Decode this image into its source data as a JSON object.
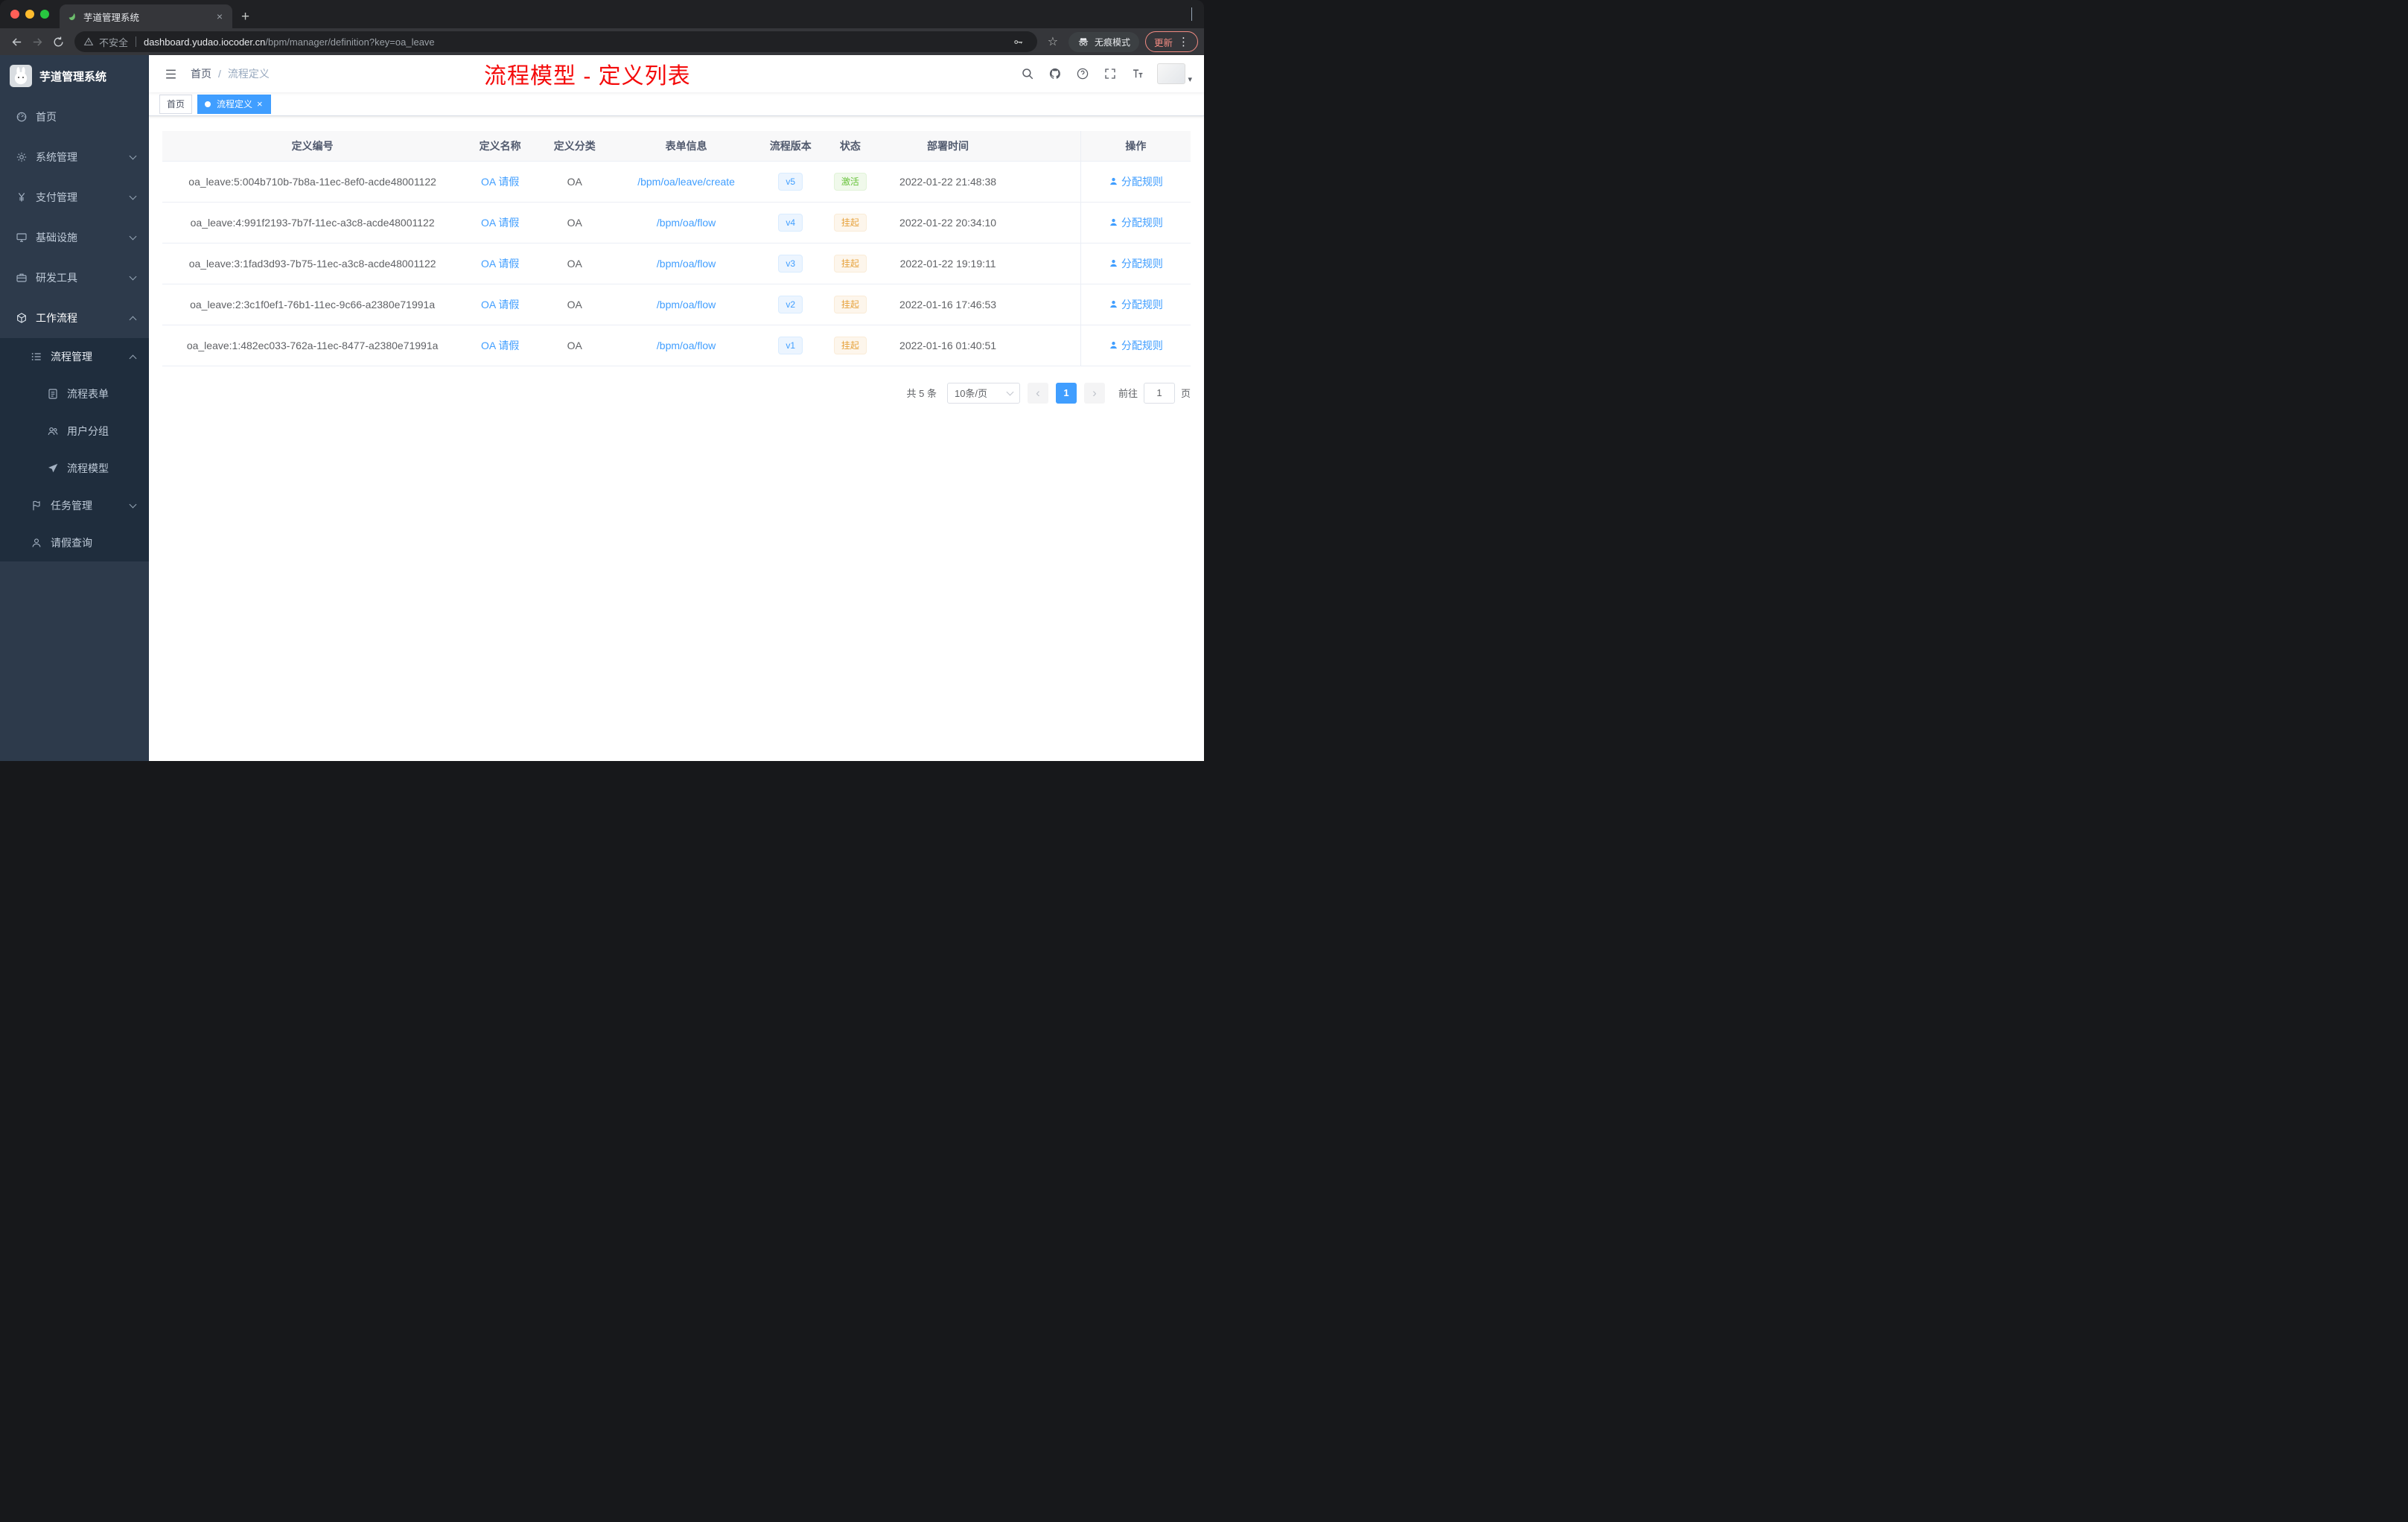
{
  "colors": {
    "accent": "#409eff",
    "success": "#67c23a",
    "warning": "#e6a23c",
    "annotation_red": "#f40b0b",
    "sidebar_bg": "#2d3a4b",
    "submenu_bg": "#1f2d3d"
  },
  "glyphs": {
    "close": "×",
    "plus": "+",
    "star": "☆",
    "dots": "⋮",
    "caret": "▾",
    "prev": "‹",
    "next": "›"
  },
  "browser": {
    "tab": {
      "title": "芋道管理系统"
    },
    "toolbar": {
      "security_label": "不安全",
      "url_host": "dashboard.yudao.iocoder.cn",
      "url_path": "/bpm/manager/definition?key=oa_leave",
      "incognito_label": "无痕模式",
      "update_label": "更新"
    }
  },
  "sidebar": {
    "logo_title": "芋道管理系统",
    "items": [
      {
        "icon": "dashboard",
        "label": "首页",
        "level": 1,
        "arrow": ""
      },
      {
        "icon": "gear",
        "label": "系统管理",
        "level": 1,
        "arrow": "down"
      },
      {
        "icon": "yen",
        "label": "支付管理",
        "level": 1,
        "arrow": "down"
      },
      {
        "icon": "monitor",
        "label": "基础设施",
        "level": 1,
        "arrow": "down"
      },
      {
        "icon": "briefcase",
        "label": "研发工具",
        "level": 1,
        "arrow": "down"
      },
      {
        "icon": "cube",
        "label": "工作流程",
        "level": 1,
        "arrow": "up",
        "state": "active"
      },
      {
        "icon": "list",
        "label": "流程管理",
        "level": 2,
        "arrow": "up",
        "state": "open"
      },
      {
        "icon": "document",
        "label": "流程表单",
        "level": 3,
        "arrow": ""
      },
      {
        "icon": "users",
        "label": "用户分组",
        "level": 3,
        "arrow": ""
      },
      {
        "icon": "send",
        "label": "流程模型",
        "level": 3,
        "arrow": ""
      },
      {
        "icon": "flag",
        "label": "任务管理",
        "level": 2,
        "arrow": "down"
      },
      {
        "icon": "user",
        "label": "请假查询",
        "level": 2,
        "arrow": ""
      }
    ]
  },
  "navbar": {
    "breadcrumb": {
      "home": "首页",
      "separator": "/",
      "current": "流程定义"
    },
    "annotation": "流程模型 - 定义列表"
  },
  "tags": {
    "home": {
      "label": "首页"
    },
    "active": {
      "label": "流程定义"
    }
  },
  "table": {
    "columns": [
      "定义编号",
      "定义名称",
      "定义分类",
      "表单信息",
      "流程版本",
      "状态",
      "部署时间",
      "操作"
    ],
    "rows": [
      {
        "id": "oa_leave:5:004b710b-7b8a-11ec-8ef0-acde48001122",
        "name": "OA 请假",
        "category": "OA",
        "form": "/bpm/oa/leave/create",
        "version": "v5",
        "status": "激活",
        "status_type": "success",
        "time": "2022-01-22 21:48:38",
        "action": "分配规则"
      },
      {
        "id": "oa_leave:4:991f2193-7b7f-11ec-a3c8-acde48001122",
        "name": "OA 请假",
        "category": "OA",
        "form": "/bpm/oa/flow",
        "version": "v4",
        "status": "挂起",
        "status_type": "warning",
        "time": "2022-01-22 20:34:10",
        "action": "分配规则"
      },
      {
        "id": "oa_leave:3:1fad3d93-7b75-11ec-a3c8-acde48001122",
        "name": "OA 请假",
        "category": "OA",
        "form": "/bpm/oa/flow",
        "version": "v3",
        "status": "挂起",
        "status_type": "warning",
        "time": "2022-01-22 19:19:11",
        "action": "分配规则"
      },
      {
        "id": "oa_leave:2:3c1f0ef1-76b1-11ec-9c66-a2380e71991a",
        "name": "OA 请假",
        "category": "OA",
        "form": "/bpm/oa/flow",
        "version": "v2",
        "status": "挂起",
        "status_type": "warning",
        "time": "2022-01-16 17:46:53",
        "action": "分配规则"
      },
      {
        "id": "oa_leave:1:482ec033-762a-11ec-8477-a2380e71991a",
        "name": "OA 请假",
        "category": "OA",
        "form": "/bpm/oa/flow",
        "version": "v1",
        "status": "挂起",
        "status_type": "warning",
        "time": "2022-01-16 01:40:51",
        "action": "分配规则"
      }
    ]
  },
  "pagination": {
    "total": "共 5 条",
    "page_size": "10条/页",
    "page": "1",
    "goto_label": "前往",
    "goto_value": "1",
    "goto_unit": "页"
  }
}
